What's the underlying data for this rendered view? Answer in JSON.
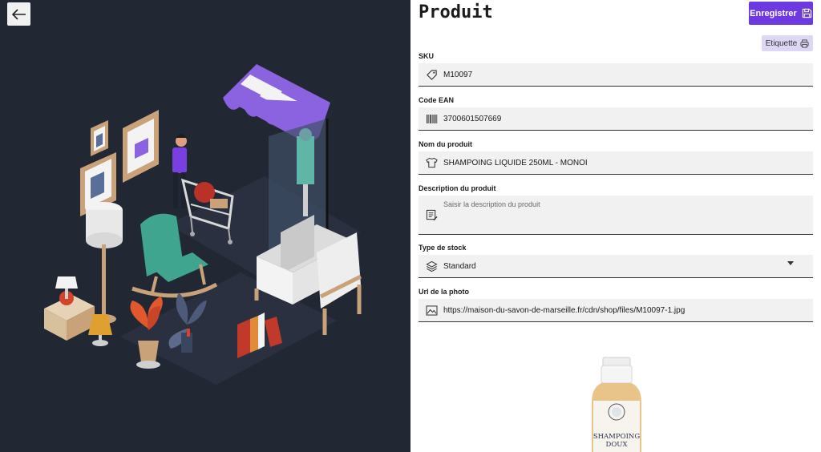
{
  "page": {
    "title": "Produit",
    "save_label": "Enregistrer",
    "etiquette_label": "Etiquette"
  },
  "fields": {
    "sku": {
      "label": "SKU",
      "value": "M10097",
      "icon": "tag-icon"
    },
    "ean": {
      "label": "Code EAN",
      "value": "3700601507669",
      "icon": "barcode-icon"
    },
    "name": {
      "label": "Nom du produit",
      "value": "SHAMPOING LIQUIDE 250ML - MONOI",
      "icon": "shirt-icon"
    },
    "description": {
      "label": "Description du produit",
      "placeholder": "Saisir la description du produit",
      "icon": "edit-note-icon"
    },
    "stock_type": {
      "label": "Type de stock",
      "value": "Standard",
      "icon": "layers-icon"
    },
    "photo_url": {
      "label": "Url de la photo",
      "value": "https://maison-du-savon-de-marseille.fr/cdn/shop/files/M10097-1.jpg",
      "icon": "image-icon"
    }
  },
  "product_image": {
    "label_line1": "SHAMPOING",
    "label_line2": "DOUX"
  },
  "colors": {
    "accent": "#6c3ae0",
    "accent_light": "#ddd6f5",
    "left_panel_bg": "#222734",
    "input_bg": "#f1f1f1"
  }
}
